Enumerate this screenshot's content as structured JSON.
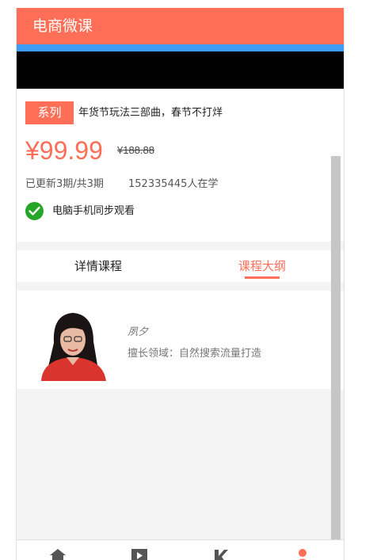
{
  "header": {
    "title": "电商微课"
  },
  "course": {
    "badge": "系列",
    "title": "年货节玩法三部曲，春节不打烊",
    "price": "¥99.99",
    "original_price": "¥188.88",
    "updates": "已更新3期/共3期",
    "learners": "152335445人在学",
    "sync_note": "电脑手机同步观看"
  },
  "tabs": [
    {
      "label": "详情课程",
      "active": false
    },
    {
      "label": "课程大纲",
      "active": true
    }
  ],
  "teacher": {
    "name": "夙夕",
    "field": "擅长领域：自然搜索流量打造"
  },
  "bottom_nav": [
    {
      "icon": "home-icon"
    },
    {
      "icon": "play-icon"
    },
    {
      "icon": "k-icon"
    },
    {
      "icon": "user-icon"
    }
  ],
  "colors": {
    "accent": "#ff6f57",
    "blue": "#3f9cf4",
    "check": "#26a626"
  }
}
